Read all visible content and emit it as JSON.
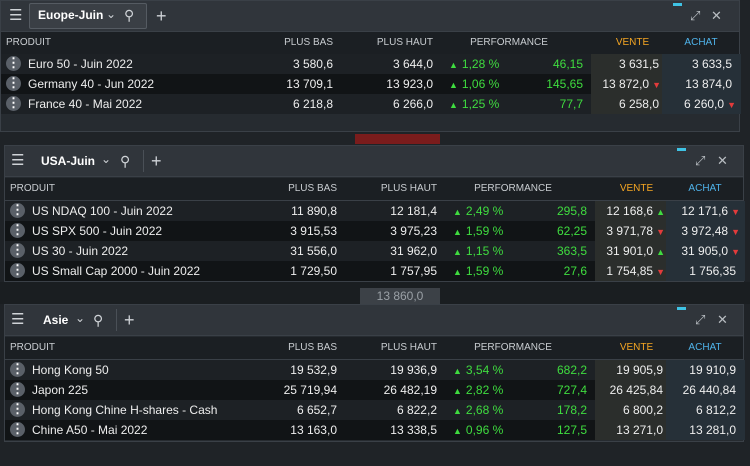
{
  "colors": {
    "up": "#3fdc3f",
    "down": "#e23b3b",
    "sell_header": "#f5a623",
    "buy_header": "#4fb3ea",
    "grip": "#3fc3e5"
  },
  "icons": {
    "menu": "hamburger-icon",
    "dropdown": "chevron-down-icon",
    "zoom": "magnifier-plus-icon",
    "add": "plus-icon",
    "expand": "expand-icon",
    "close": "close-icon",
    "row_menu": "vertical-dots-icon",
    "arrow_up": "triangle-up-icon",
    "arrow_down": "triangle-down-icon"
  },
  "background_text": "13 860,0",
  "headers": {
    "product": "PRODUIT",
    "low": "PLUS BAS",
    "high": "PLUS HAUT",
    "performance": "PERFORMANCE",
    "sell": "VENTE",
    "buy": "ACHAT"
  },
  "panels": [
    {
      "name": "Euope-Juin",
      "has_zoom": false,
      "rows": [
        {
          "product": "Euro 50 - Juin 2022",
          "low": "3 580,6",
          "high": "3 644,0",
          "perf_pct": "1,28 %",
          "perf_dir": "up",
          "perf_val": "46,15",
          "sell": "3 631,5",
          "sell_dir": "",
          "buy": "3 633,5",
          "buy_dir": ""
        },
        {
          "product": "Germany 40 - Jun 2022",
          "low": "13 709,1",
          "high": "13 923,0",
          "perf_pct": "1,06 %",
          "perf_dir": "up",
          "perf_val": "145,65",
          "sell": "13 872,0",
          "sell_dir": "down",
          "buy": "13 874,0",
          "buy_dir": ""
        },
        {
          "product": "France 40 - Mai 2022",
          "low": "6 218,8",
          "high": "6 266,0",
          "perf_pct": "1,25 %",
          "perf_dir": "up",
          "perf_val": "77,7",
          "sell": "6 258,0",
          "sell_dir": "",
          "buy": "6 260,0",
          "buy_dir": "down"
        }
      ]
    },
    {
      "name": "USA-Juin",
      "has_zoom": true,
      "rows": [
        {
          "product": "US NDAQ 100 - Juin 2022",
          "low": "11 890,8",
          "high": "12 181,4",
          "perf_pct": "2,49 %",
          "perf_dir": "up",
          "perf_val": "295,8",
          "sell": "12 168,6",
          "sell_dir": "up",
          "buy": "12 171,6",
          "buy_dir": "down"
        },
        {
          "product": "US SPX 500 - Juin 2022",
          "low": "3 915,53",
          "high": "3 975,23",
          "perf_pct": "1,59 %",
          "perf_dir": "up",
          "perf_val": "62,25",
          "sell": "3 971,78",
          "sell_dir": "down",
          "buy": "3 972,48",
          "buy_dir": "down"
        },
        {
          "product": "US 30 - Juin 2022",
          "low": "31 556,0",
          "high": "31 962,0",
          "perf_pct": "1,15 %",
          "perf_dir": "up",
          "perf_val": "363,5",
          "sell": "31 901,0",
          "sell_dir": "up",
          "buy": "31 905,0",
          "buy_dir": "down"
        },
        {
          "product": "US Small Cap 2000 - Juin 2022",
          "low": "1 729,50",
          "high": "1 757,95",
          "perf_pct": "1,59 %",
          "perf_dir": "up",
          "perf_val": "27,6",
          "sell": "1 754,85",
          "sell_dir": "down",
          "buy": "1 756,35",
          "buy_dir": ""
        }
      ]
    },
    {
      "name": "Asie",
      "has_zoom": true,
      "rows": [
        {
          "product": "Hong Kong 50",
          "low": "19 532,9",
          "high": "19 936,9",
          "perf_pct": "3,54 %",
          "perf_dir": "up",
          "perf_val": "682,2",
          "sell": "19 905,9",
          "sell_dir": "",
          "buy": "19 910,9",
          "buy_dir": ""
        },
        {
          "product": "Japon 225",
          "low": "25 719,94",
          "high": "26 482,19",
          "perf_pct": "2,82 %",
          "perf_dir": "up",
          "perf_val": "727,4",
          "sell": "26 425,84",
          "sell_dir": "",
          "buy": "26 440,84",
          "buy_dir": ""
        },
        {
          "product": "Hong Kong Chine H-shares - Cash",
          "low": "6 652,7",
          "high": "6 822,2",
          "perf_pct": "2,68 %",
          "perf_dir": "up",
          "perf_val": "178,2",
          "sell": "6 800,2",
          "sell_dir": "",
          "buy": "6 812,2",
          "buy_dir": ""
        },
        {
          "product": "Chine A50 - Mai 2022",
          "low": "13 163,0",
          "high": "13 338,5",
          "perf_pct": "0,96 %",
          "perf_dir": "up",
          "perf_val": "127,5",
          "sell": "13 271,0",
          "sell_dir": "",
          "buy": "13 281,0",
          "buy_dir": ""
        }
      ]
    }
  ]
}
